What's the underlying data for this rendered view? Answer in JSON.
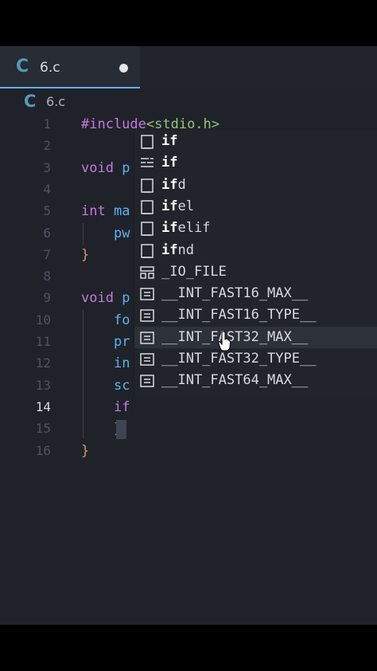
{
  "tab": {
    "icon": "C",
    "label": "6.c",
    "dirty": true
  },
  "breadcrumb": {
    "icon": "C",
    "label": "6.c"
  },
  "lines": [
    {
      "num": "1",
      "parts": [
        {
          "c": "inc",
          "t": "#include"
        },
        {
          "c": "hdr",
          "t": "<stdio.h>"
        }
      ]
    },
    {
      "num": "2",
      "parts": []
    },
    {
      "num": "3",
      "parts": [
        {
          "c": "ty",
          "t": "void"
        },
        {
          "c": "pl",
          "t": " "
        },
        {
          "c": "fn",
          "t": "p"
        }
      ]
    },
    {
      "num": "4",
      "parts": []
    },
    {
      "num": "5",
      "parts": [
        {
          "c": "ty",
          "t": "int"
        },
        {
          "c": "pl",
          "t": " "
        },
        {
          "c": "fn",
          "t": "ma"
        }
      ]
    },
    {
      "num": "6",
      "parts": [
        {
          "c": "pl",
          "t": "    "
        },
        {
          "c": "fn",
          "t": "pw"
        }
      ]
    },
    {
      "num": "7",
      "parts": [
        {
          "c": "brace-y",
          "t": "}"
        }
      ]
    },
    {
      "num": "8",
      "parts": []
    },
    {
      "num": "9",
      "parts": [
        {
          "c": "ty",
          "t": "void"
        },
        {
          "c": "pl",
          "t": " "
        },
        {
          "c": "fn",
          "t": "p"
        }
      ]
    },
    {
      "num": "10",
      "parts": [
        {
          "c": "pl",
          "t": "    "
        },
        {
          "c": "fn",
          "t": "fo"
        }
      ]
    },
    {
      "num": "11",
      "parts": [
        {
          "c": "pl",
          "t": "    "
        },
        {
          "c": "fn",
          "t": "pr"
        }
      ]
    },
    {
      "num": "12",
      "parts": [
        {
          "c": "pl",
          "t": "    "
        },
        {
          "c": "fn",
          "t": "in"
        }
      ]
    },
    {
      "num": "13",
      "parts": [
        {
          "c": "pl",
          "t": "    "
        },
        {
          "c": "fn",
          "t": "sc"
        }
      ]
    },
    {
      "num": "14",
      "parts": [
        {
          "c": "pl",
          "t": "    "
        },
        {
          "c": "kw",
          "t": "if"
        }
      ],
      "active": true
    },
    {
      "num": "15",
      "parts": [
        {
          "c": "pl",
          "t": "    "
        },
        {
          "c": "pl",
          "t": "}"
        }
      ]
    },
    {
      "num": "16",
      "parts": [
        {
          "c": "brace-y",
          "t": "}"
        }
      ]
    }
  ],
  "suggestions": [
    {
      "icon": "snippet",
      "match": "if",
      "rest": ""
    },
    {
      "icon": "keyword",
      "match": "if",
      "rest": ""
    },
    {
      "icon": "snippet",
      "match": "if",
      "rest": "d"
    },
    {
      "icon": "snippet",
      "match": "if",
      "rest": "el"
    },
    {
      "icon": "snippet",
      "match": "if",
      "rest": "elif"
    },
    {
      "icon": "snippet",
      "match": "if",
      "rest": "nd"
    },
    {
      "icon": "struct",
      "match": "",
      "rest": "_IO_FILE"
    },
    {
      "icon": "constant",
      "match": "",
      "rest": "__INT_FAST16_MAX__"
    },
    {
      "icon": "constant",
      "match": "",
      "rest": "__INT_FAST16_TYPE__"
    },
    {
      "icon": "constant",
      "match": "",
      "rest": "__INT_FAST32_MAX__"
    },
    {
      "icon": "constant",
      "match": "",
      "rest": "__INT_FAST32_TYPE__"
    },
    {
      "icon": "constant",
      "match": "",
      "rest": "__INT_FAST64_MAX__"
    }
  ],
  "selected_suggestion": 9,
  "colors": {
    "background": "#1f2329",
    "keyword": "#c678dd",
    "function": "#61afef",
    "string": "#98c379",
    "c_icon": "#519aba"
  }
}
